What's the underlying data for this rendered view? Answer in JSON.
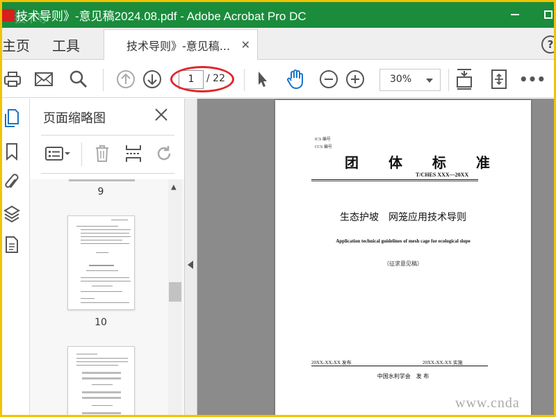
{
  "window": {
    "title": "技术导则》-意见稿2024.08.pdf - Adobe Acrobat Pro DC",
    "logo_overlay_text": "技术导",
    "colors": {
      "titlebar": "#1a8c3c",
      "outer_border": "#f2c300",
      "annotation": "#e0262a"
    }
  },
  "tabs": {
    "home": "主页",
    "tools": "工具",
    "document": "技术导则》-意见稿...",
    "close": "✕",
    "help": "?"
  },
  "toolbar": {
    "current_page": "1",
    "total_pages": "/ 22",
    "zoom": "30%",
    "more": "•••",
    "icons": [
      "print-icon",
      "email-icon",
      "search-icon",
      "prev-page-icon",
      "next-page-icon",
      "select-cursor-icon",
      "hand-tool-icon",
      "zoom-out-icon",
      "zoom-in-icon",
      "fit-page-icon",
      "scroll-mode-icon",
      "more-icon"
    ]
  },
  "sidebar": {
    "icons": [
      "page-thumbnails-icon",
      "bookmarks-icon",
      "attachments-icon",
      "layers-icon",
      "document-properties-icon"
    ]
  },
  "panel": {
    "title": "页面缩略图",
    "thumbnails": [
      {
        "label": "9"
      },
      {
        "label": "10"
      },
      {
        "label": ""
      }
    ]
  },
  "document": {
    "ics": "ICS 编号",
    "ccs": "CCS 编号",
    "standard_title": "团 体 标 准",
    "standard_code": "T/CHES XXX—20XX",
    "cn_title": "生态护坡　网笼应用技术导则",
    "en_title": "Application technical guidelines of mesh cage for ecological slope",
    "draft_note": "（征求意见稿）",
    "issue_date": "20XX-XX-XX 发布",
    "impl_date": "20XX-XX-XX 实施",
    "organization": "中国水利学会　发 布"
  },
  "watermark": "www.cnda"
}
